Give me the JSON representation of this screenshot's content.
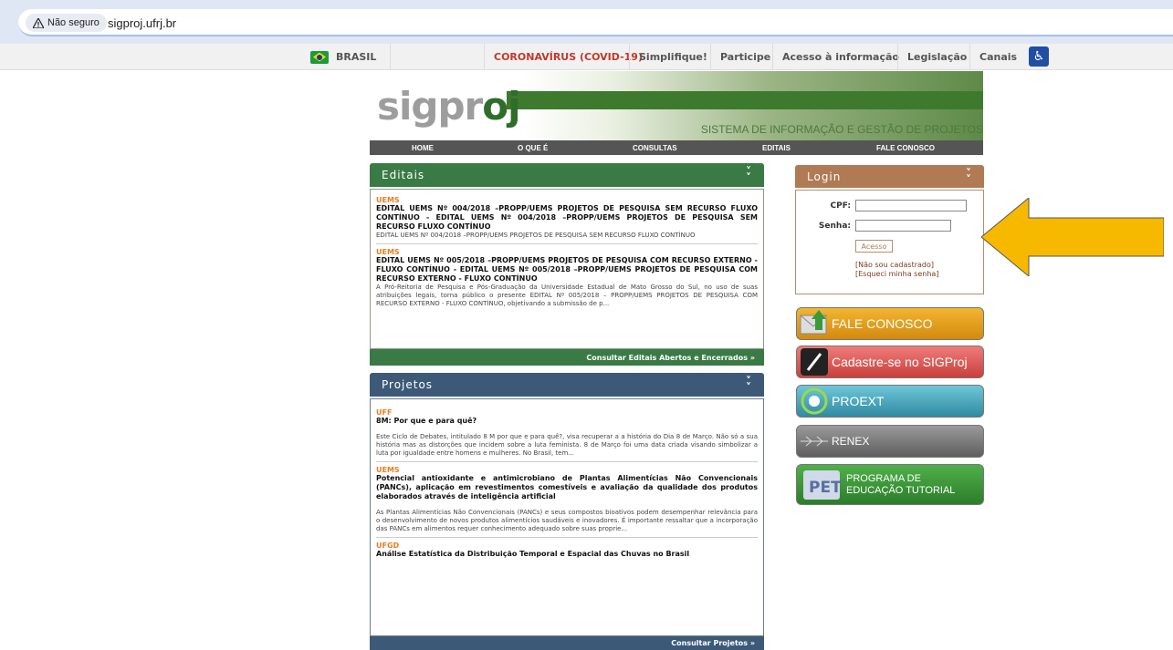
{
  "browser": {
    "security_label": "Não seguro",
    "url": "sigproj.ufrj.br"
  },
  "govbar": {
    "country": "BRASIL",
    "items": [
      "CORONAVÍRUS (COVID-19)",
      "Simplifique!",
      "Participe",
      "Acesso à informação",
      "Legislação",
      "Canais"
    ]
  },
  "header": {
    "logo_a": "sigpr",
    "logo_b": "oj",
    "tagline": "SISTEMA DE INFORMAÇÃO E GESTÃO DE PROJETOS",
    "nav": [
      "HOME",
      "O QUE É",
      "CONSULTAS",
      "EDITAIS",
      "FALE CONOSCO"
    ]
  },
  "editais": {
    "title": "Editais",
    "items": [
      {
        "org": "UEMS",
        "title": "EDITAL UEMS Nº 004/2018 –PROPP/UEMS PROJETOS DE PESQUISA SEM RECURSO FLUXO CONTÍNUO - EDITAL UEMS Nº 004/2018 –PROPP/UEMS PROJETOS DE PESQUISA SEM RECURSO FLUXO CONTÍNUO",
        "desc": "EDITAL UEMS Nº 004/2018 –PROPP/UEMS PROJETOS DE PESQUISA SEM RECURSO FLUXO CONTÍNUO"
      },
      {
        "org": "UEMS",
        "title": "EDITAL UEMS Nº 005/2018 –PROPP/UEMS PROJETOS DE PESQUISA COM RECURSO EXTERNO - FLUXO CONTÍNUO - EDITAL UEMS Nº 005/2018 –PROPP/UEMS PROJETOS DE PESQUISA COM RECURSO EXTERNO - FLUXO CONTÍNUO",
        "desc": "A Pró-Reitoria de Pesquisa e Pós-Graduação da Universidade Estadual de Mato Grosso do Sul, no uso de suas atribuições legais, torna público o presente EDITAL Nº 005/2018 – PROPP/UEMS PROJETOS DE PESQUISA COM RECURSO EXTERNO - FLUXO CONTÍNUO, objetivando a submissão de p..."
      }
    ],
    "footer": "Consultar Editais Abertos e Encerrados »"
  },
  "projetos": {
    "title": "Projetos",
    "items": [
      {
        "org": "UFF",
        "title": "8M: Por que e para quê?",
        "desc": "Este Ciclo de Debates, intitulado 8 M por que e para quê?, visa recuperar a a história do Dia 8 de Março. Não só a sua história mas as distorções que incidem sobre a luta feminista. 8 de Março foi uma data criada visando simbolizar a luta por igualdade entre homens e mulheres. No Brasil, tem..."
      },
      {
        "org": "UEMS",
        "title": "Potencial antioxidante e antimicrobiano de Plantas Alimentícias Não Convencionais (PANCs), aplicação em revestimentos comestíveis e avaliação da qualidade dos produtos elaborados através de inteligência artificial",
        "desc": "As Plantas Alimentícias Não Convencionais (PANCs) e seus compostos bioativos podem desempenhar relevância para o desenvolvimento de novos produtos alimentícios saudáveis e inovadores. É importante ressaltar que a incorporação das PANCs em alimentos requer conhecimento adequado sobre suas proprie..."
      },
      {
        "org": "UFGD",
        "title": "Análise Estatística da Distribuição Temporal e Espacial das Chuvas no Brasil",
        "desc": ""
      }
    ],
    "footer": "Consultar Projetos »"
  },
  "login": {
    "title": "Login",
    "cpf_label": "CPF:",
    "senha_label": "Senha:",
    "button": "Acesso",
    "link1": "[Não sou cadastrado]",
    "link2": "[Esqueci minha senha]"
  },
  "side_buttons": [
    {
      "label": "FALE CONOSCO",
      "color": "#e8a21c"
    },
    {
      "label": "Cadastre-se no SIGProj",
      "color": "#d9534f"
    },
    {
      "label": "PROEXT",
      "color": "#3aa0b8"
    },
    {
      "label": "RENEX",
      "color": "#7a7a7a"
    },
    {
      "label": "PROGRAMA DE EDUCAÇÃO TUTORIAL",
      "color": "#3e9a3a"
    }
  ],
  "colors": {
    "green": "#3a7a45",
    "blue": "#3c5a78",
    "login": "#b07a55",
    "arrow": "#f7b900"
  }
}
